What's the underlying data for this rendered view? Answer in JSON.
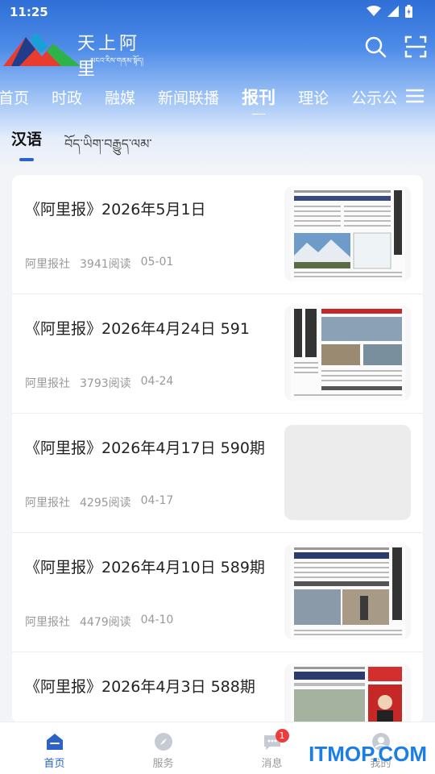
{
  "status": {
    "time": "11:25"
  },
  "brand": {
    "name": "天上阿里",
    "sub": "མངའ་རིས་གནམ་སྟོད།"
  },
  "nav": {
    "tabs": [
      {
        "label": "首页"
      },
      {
        "label": "时政"
      },
      {
        "label": "融媒"
      },
      {
        "label": "新闻联播"
      },
      {
        "label": "报刊",
        "active": true
      },
      {
        "label": "理论"
      },
      {
        "label": "公示公"
      }
    ]
  },
  "subtabs": [
    {
      "label": "汉语",
      "active": true
    },
    {
      "label": "བོད་ཡིག་བརྒྱུད་ལམ་"
    }
  ],
  "articles": [
    {
      "title": "《阿里报》2026年5月1日",
      "source": "阿里报社",
      "reads": "3941阅读",
      "date": "05-01",
      "thumb": true
    },
    {
      "title": "《阿里报》2026年4月24日 591",
      "source": "阿里报社",
      "reads": "3793阅读",
      "date": "04-24",
      "thumb": true
    },
    {
      "title": "《阿里报》2026年4月17日 590期",
      "source": "阿里报社",
      "reads": "4295阅读",
      "date": "04-17",
      "thumb": false
    },
    {
      "title": "《阿里报》2026年4月10日 589期",
      "source": "阿里报社",
      "reads": "4479阅读",
      "date": "04-10",
      "thumb": true
    },
    {
      "title": "《阿里报》2026年4月3日 588期",
      "source": "",
      "reads": "",
      "date": "",
      "thumb": true
    }
  ],
  "tabbar": [
    {
      "label": "首页",
      "icon": "home-icon",
      "active": true
    },
    {
      "label": "服务",
      "icon": "compass-icon"
    },
    {
      "label": "消息",
      "icon": "chat-icon",
      "badge": "1"
    },
    {
      "label": "我的",
      "icon": "user-icon"
    }
  ],
  "watermark": "ITMOP.COM",
  "colors": {
    "accent": "#2c63c8",
    "header": "#2f6fd6",
    "badge": "#ee3b3b"
  }
}
